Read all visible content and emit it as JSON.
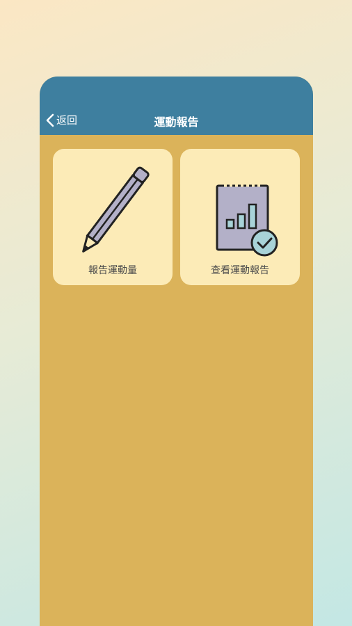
{
  "header": {
    "back_label": "返回",
    "title": "運動報告"
  },
  "cards": [
    {
      "label": "報告運動量",
      "icon": "pencil-icon"
    },
    {
      "label": "查看運動報告",
      "icon": "report-chart-check-icon"
    }
  ],
  "colors": {
    "header_bg": "#3e7f9f",
    "panel_bg": "#dbb35a",
    "card_bg": "#fcebb7",
    "icon_fill": "#b3b0c8",
    "check_fill": "#a8d3d8"
  }
}
